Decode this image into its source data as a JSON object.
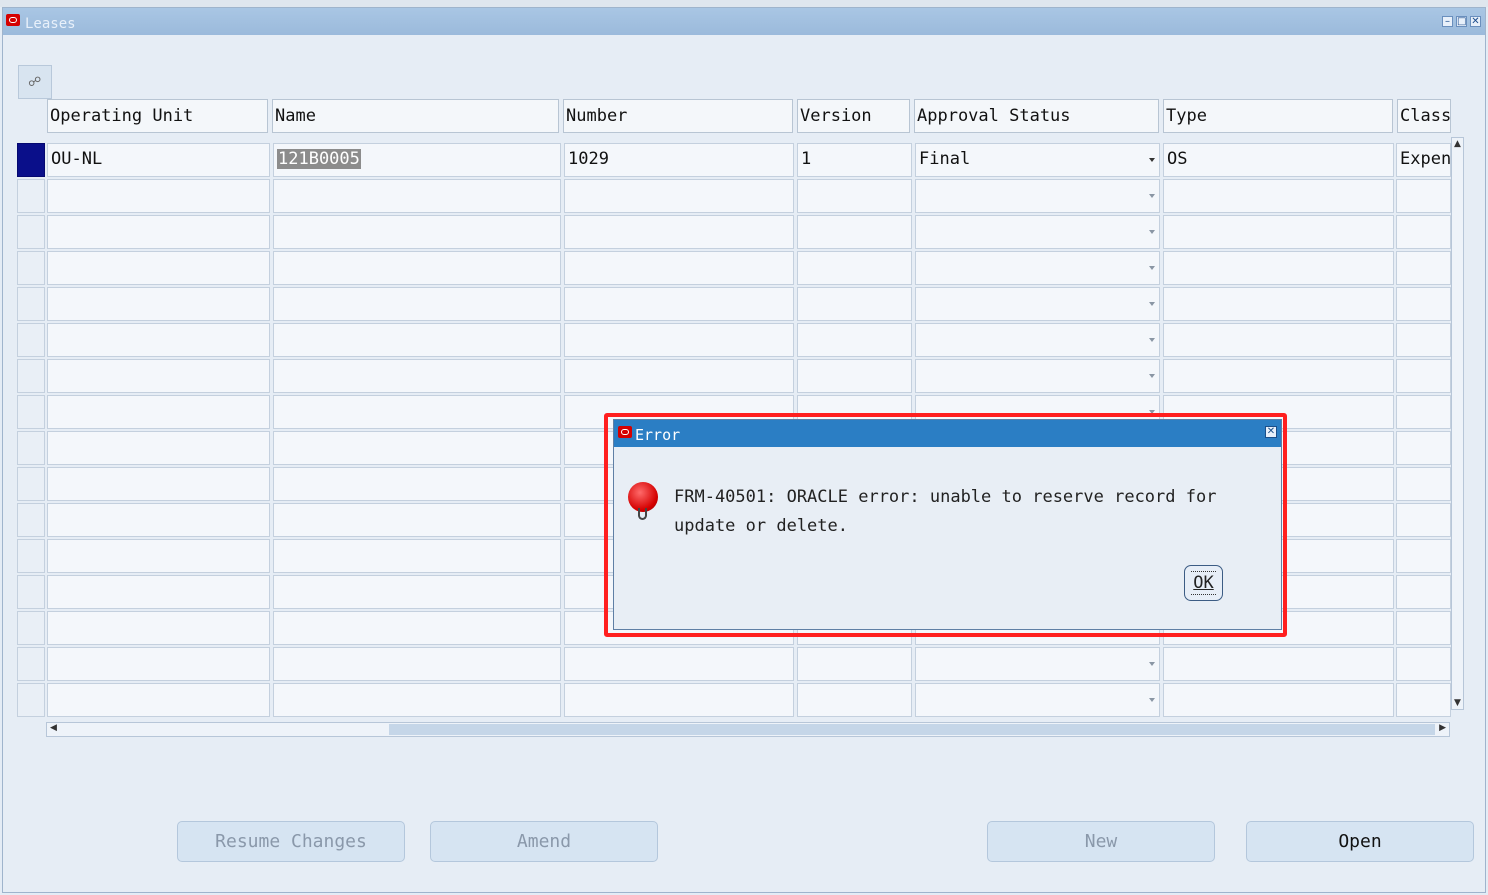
{
  "window": {
    "title": "Leases"
  },
  "table": {
    "columns": [
      "Operating Unit",
      "Name",
      "Number",
      "Version",
      "Approval Status",
      "Type",
      "Class"
    ],
    "rows": [
      {
        "operating_unit": "OU-NL",
        "name": "121B0005",
        "number": "1029",
        "version": "1",
        "approval_status": "Final",
        "type": "OS",
        "class": "Expen"
      }
    ]
  },
  "buttons": {
    "resume_changes": "Resume Changes",
    "amend": "Amend",
    "new": "New",
    "open": "Open"
  },
  "error_dialog": {
    "title": "Error",
    "message": "FRM-40501: ORACLE error: unable to reserve record for update or delete.",
    "ok_label": "OK",
    "highlight_color": "#ff1f1f"
  },
  "colors": {
    "titlebar": "#a9c6e4",
    "dialog_titlebar": "#2b7ec4",
    "active_row_marker": "#0a0f8a",
    "selected_text_bg": "#8c8c8c"
  }
}
